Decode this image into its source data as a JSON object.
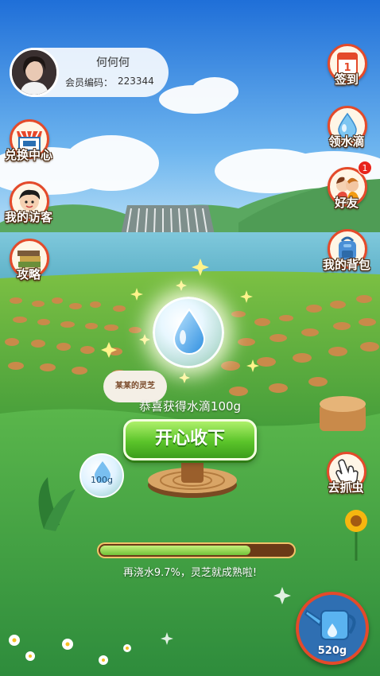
{
  "profile": {
    "name": "何何何",
    "member_id_label": "会员编码：",
    "member_id": "223344"
  },
  "left_menu": [
    {
      "label": "兑换中心",
      "icon": "shop-icon"
    },
    {
      "label": "我的访客",
      "icon": "visitor-icon"
    },
    {
      "label": "攻略",
      "icon": "books-icon"
    }
  ],
  "right_menu": [
    {
      "label": "签到",
      "icon": "calendar-icon",
      "calendar_day": "1"
    },
    {
      "label": "领水滴",
      "icon": "water-drop-icon"
    },
    {
      "label": "好友",
      "icon": "friends-icon",
      "badge": "1"
    },
    {
      "label": "我的背包",
      "icon": "backpack-icon"
    }
  ],
  "reward": {
    "plant_sign": "某某的灵芝",
    "message": "恭喜获得水滴100g",
    "button_label": "开心收下"
  },
  "small_drop": {
    "label": "100g"
  },
  "catch_bug": {
    "label": "去抓虫",
    "icon": "hand-pointer-icon"
  },
  "growth": {
    "progress": 0.78,
    "message": "再浇水9.7%，灵芝就成熟啦!"
  },
  "watering_can": {
    "label": "520g",
    "icon": "watering-can-icon"
  },
  "colors": {
    "accent_red": "#e44a2a",
    "button_green": "#5bc42a",
    "progress_bg": "#6b3a17"
  }
}
